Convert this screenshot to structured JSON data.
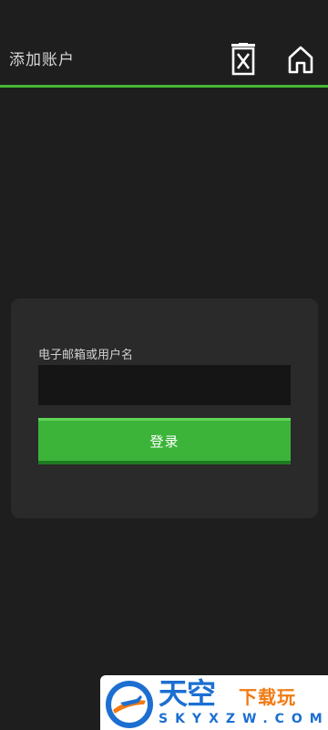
{
  "header": {
    "title": "添加账户",
    "delete_icon": "delete-account-icon",
    "home_icon": "home-icon",
    "accent_color": "#46b534"
  },
  "login": {
    "field_label": "电子邮箱或用户名",
    "field_value": "",
    "button_label": "登录",
    "button_color": "#3cb43a"
  },
  "watermark": {
    "title": "天空",
    "subtitle": "下载玩",
    "domain": "SKYXZW.COM"
  }
}
